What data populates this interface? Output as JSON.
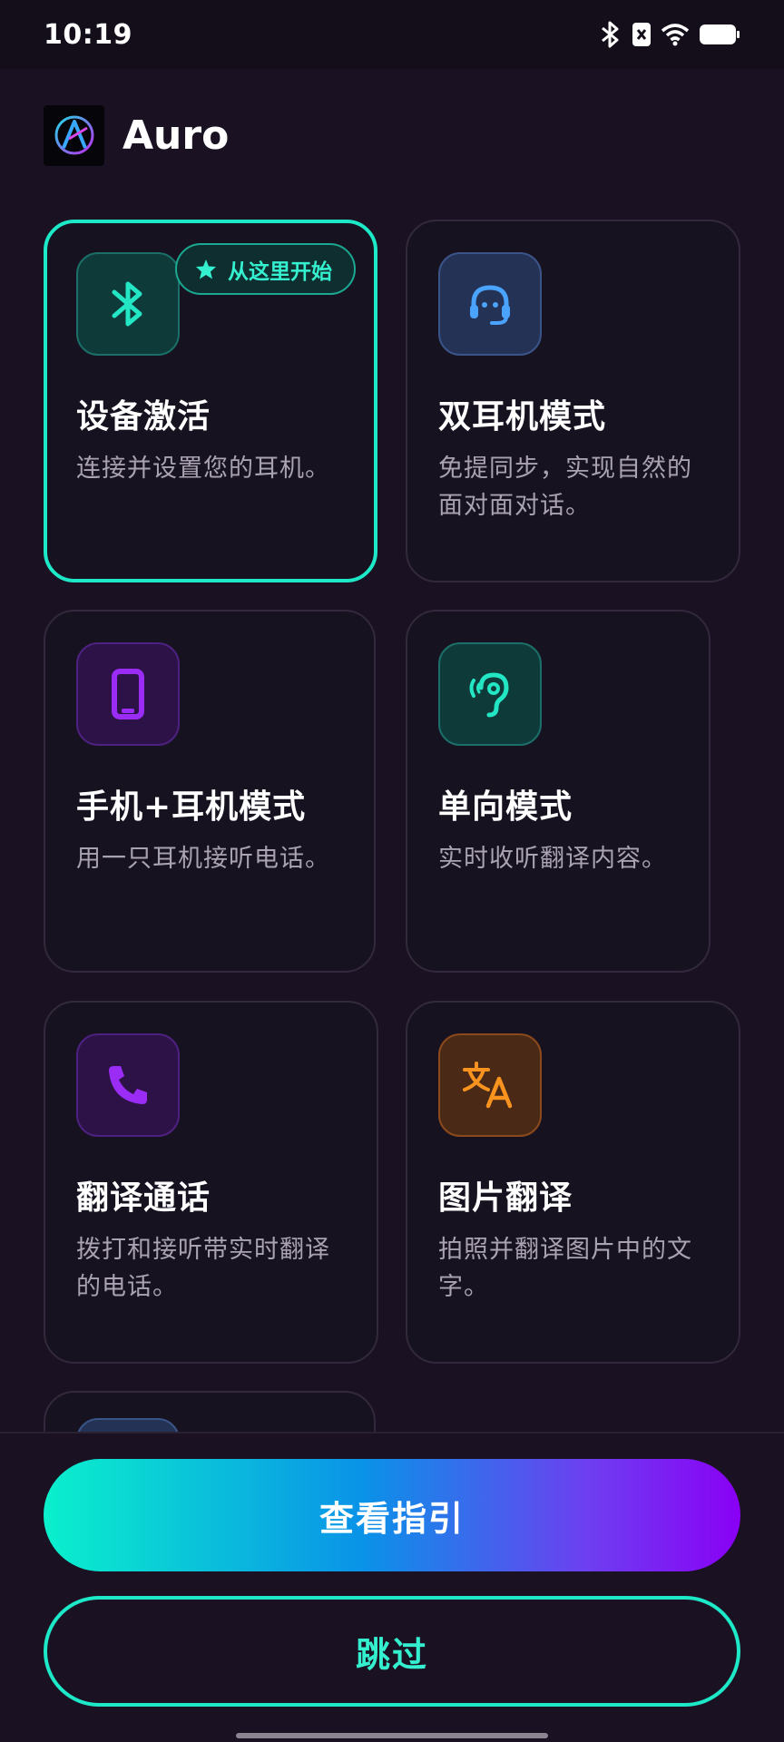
{
  "status_bar": {
    "time": "10:19",
    "icons": [
      "bluetooth-icon",
      "sim-off-icon",
      "wifi-icon",
      "battery-icon"
    ]
  },
  "header": {
    "app_name": "Auro"
  },
  "cards": [
    {
      "title": "设备激活",
      "desc": "连接并设置您的耳机。",
      "icon": "bluetooth-icon",
      "badge": "从这里开始"
    },
    {
      "title": "双耳机模式",
      "desc": "免提同步，实现自然的面对面对话。",
      "icon": "headset-icon"
    },
    {
      "title": "手机+耳机模式",
      "desc": "用一只耳机接听电话。",
      "icon": "phone-icon"
    },
    {
      "title": "单向模式",
      "desc": "实时收听翻译内容。",
      "icon": "ear-icon"
    },
    {
      "title": "翻译通话",
      "desc": "拨打和接听带实时翻译的电话。",
      "icon": "call-icon"
    },
    {
      "title": "图片翻译",
      "desc": "拍照并翻译图片中的文字。",
      "icon": "translate-icon"
    }
  ],
  "buttons": {
    "guide": "查看指引",
    "skip": "跳过"
  },
  "colors": {
    "accent": "#1de9c8",
    "background": "#1a1222",
    "card": "#17121f"
  }
}
